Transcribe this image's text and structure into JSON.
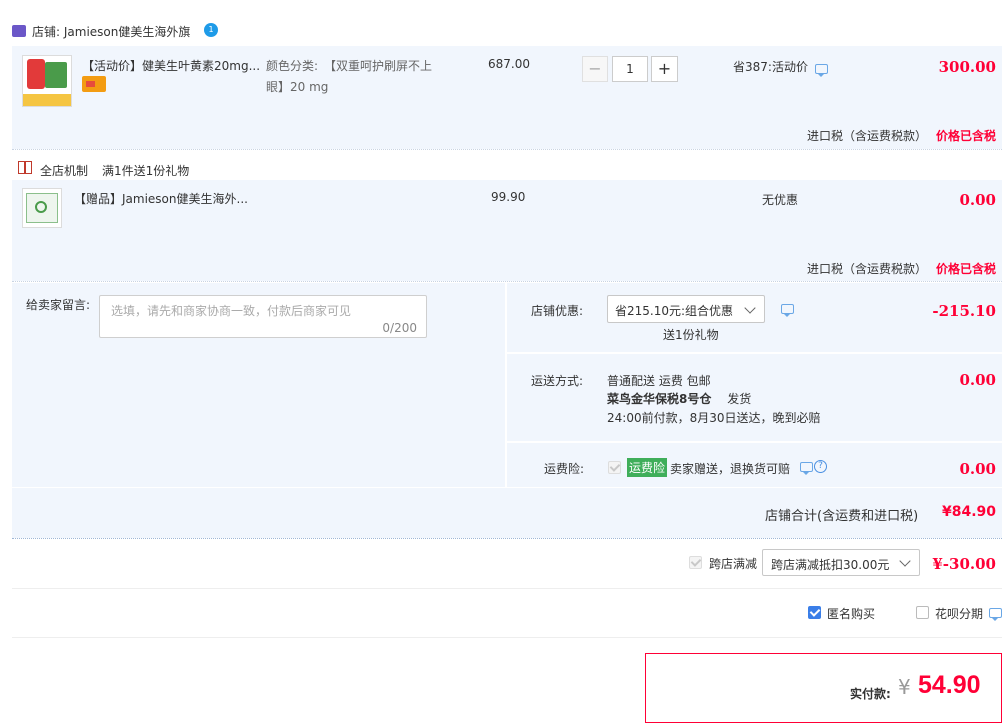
{
  "shop": {
    "prefix": "店铺: ",
    "name": "Jamieson健美生海外旗",
    "badge": "1"
  },
  "item1": {
    "title": "【活动价】健美生叶黄素20mg...",
    "spec_label": "颜色分类:",
    "spec_value_line1": "【双重呵护刷屏不上",
    "spec_value_line2": "眼】20 mg",
    "unit_price": "687.00",
    "qty_minus": "−",
    "qty": "1",
    "qty_plus": "+",
    "discount": "省387:活动价",
    "subtotal": "300.00",
    "tax_label": "进口税（含运费税款）",
    "tax_value": "价格已含税"
  },
  "promo": {
    "label": "全店机制",
    "desc": "满1件送1份礼物"
  },
  "gift": {
    "title": "【赠品】Jamieson健美生海外...",
    "unit_price": "99.90",
    "discount": "无优惠",
    "subtotal": "0.00",
    "tax_label": "进口税（含运费税款）",
    "tax_value": "价格已含税"
  },
  "message": {
    "label": "给卖家留言:",
    "placeholder": "选填，请先和商家协商一致，付款后商家可见",
    "counter": "0/200"
  },
  "shop_discount": {
    "label": "店铺优惠:",
    "selected": "省215.10元:组合优惠",
    "sub": "送1份礼物",
    "value": "-215.10"
  },
  "shipping": {
    "label": "运送方式:",
    "line1": "普通配送 运费 包邮",
    "line2_bold": "菜鸟金华保税8号仓",
    "line2_rest": "发货",
    "line3": "24:00前付款，8月30日送达，晚到必赔",
    "value": "0.00"
  },
  "insurance": {
    "label": "运费险:",
    "tag": "运费险",
    "desc": "卖家赠送，退换货可赔",
    "value": "0.00"
  },
  "shop_total": {
    "label": "店铺合计(含运费和进口税)",
    "value": "¥84.90"
  },
  "cross_shop": {
    "label": "跨店满减",
    "selected": "跨店满减抵扣30.00元",
    "value": "¥-30.00"
  },
  "options": {
    "anonymous": "匿名购买",
    "installment": "花呗分期"
  },
  "payment": {
    "label": "实付款:",
    "currency": "¥",
    "amount": "54.90"
  },
  "colors": {
    "accent_red": "#ff0036",
    "band_blue": "#f1f6fd",
    "checkbox_blue": "#3a7ee8",
    "insurance_green": "#3fae5a"
  }
}
